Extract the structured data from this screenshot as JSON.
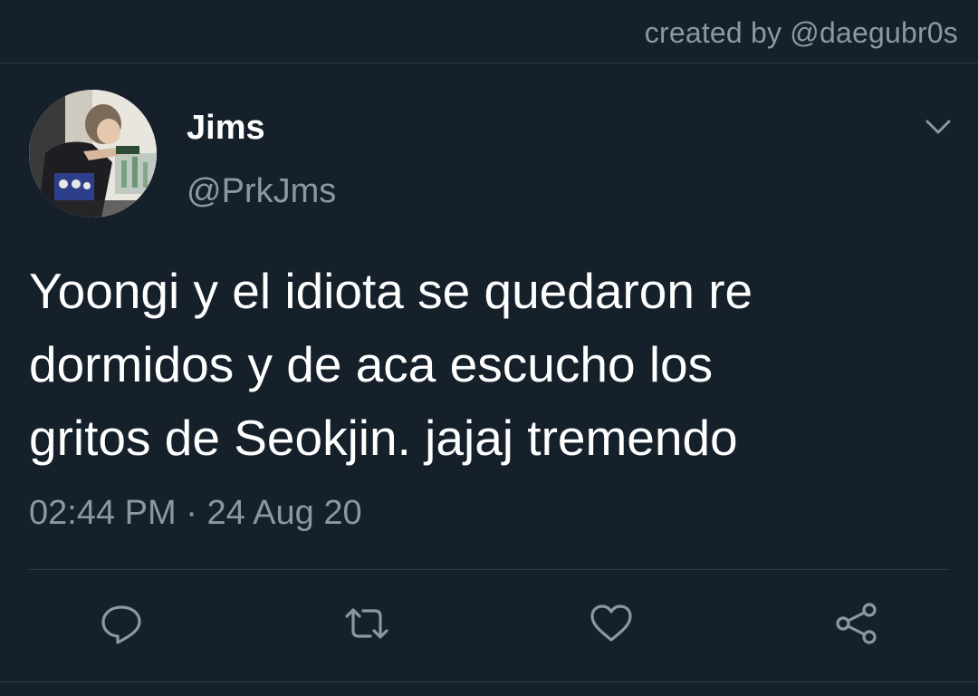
{
  "header": {
    "credit": "created by @daegubr0s"
  },
  "tweet": {
    "name": "Jims",
    "handle": "@PrkJms",
    "text_lines": [
      "Yoongi y el idiota se quedaron re",
      "dormidos y de aca escucho los",
      "gritos de Seokjin. jajaj tremendo"
    ],
    "time": "02:44 PM",
    "separator": "·",
    "date": "24 Aug 20"
  },
  "actions": [
    "reply-icon",
    "retweet-icon",
    "like-icon",
    "share-icon"
  ],
  "colors": {
    "background": "#15202b",
    "primary_text": "#ffffff",
    "secondary_text": "#8899a6",
    "divider": "#2f3d4b"
  }
}
